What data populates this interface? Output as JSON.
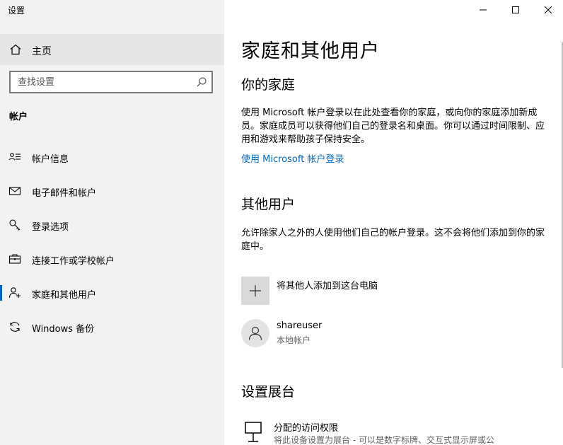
{
  "app": {
    "title": "设置"
  },
  "window_controls": {
    "minimize": "minimize",
    "maximize": "maximize",
    "close": "close"
  },
  "sidebar": {
    "home": {
      "label": "主页",
      "icon": "home-icon"
    },
    "search": {
      "placeholder": "查找设置",
      "icon": "search-icon"
    },
    "section_heading": "帐户",
    "items": [
      {
        "label": "帐户信息",
        "icon": "account-info-icon"
      },
      {
        "label": "电子邮件和帐户",
        "icon": "mail-icon"
      },
      {
        "label": "登录选项",
        "icon": "key-icon"
      },
      {
        "label": "连接工作或学校帐户",
        "icon": "briefcase-icon"
      },
      {
        "label": "家庭和其他用户",
        "icon": "family-user-icon",
        "active": true
      },
      {
        "label": "Windows 备份",
        "icon": "sync-icon"
      }
    ],
    "accent_color": "#0067c0"
  },
  "main": {
    "title": "家庭和其他用户",
    "family": {
      "heading": "你的家庭",
      "description": "使用 Microsoft 帐户登录以在此处查看你的家庭，或向你的家庭添加新成员。家庭成员可以获得他们自己的登录名和桌面。你可以通过时间限制、应用和游戏来帮助孩子保持安全。",
      "link": "使用 Microsoft 帐户登录"
    },
    "other_users": {
      "heading": "其他用户",
      "description": "允许除家人之外的人使用他们自己的帐户登录。这不会将他们添加到你的家庭中。",
      "add_label": "将其他人添加到这台电脑",
      "users": [
        {
          "name": "shareuser",
          "type": "本地帐户"
        }
      ]
    },
    "kiosk": {
      "heading": "设置展台",
      "item_title": "分配的访问权限",
      "item_desc": "将此设备设置为展台 - 可以是数字标牌、交互式显示屏或公"
    },
    "link_color": "#0067c0"
  }
}
